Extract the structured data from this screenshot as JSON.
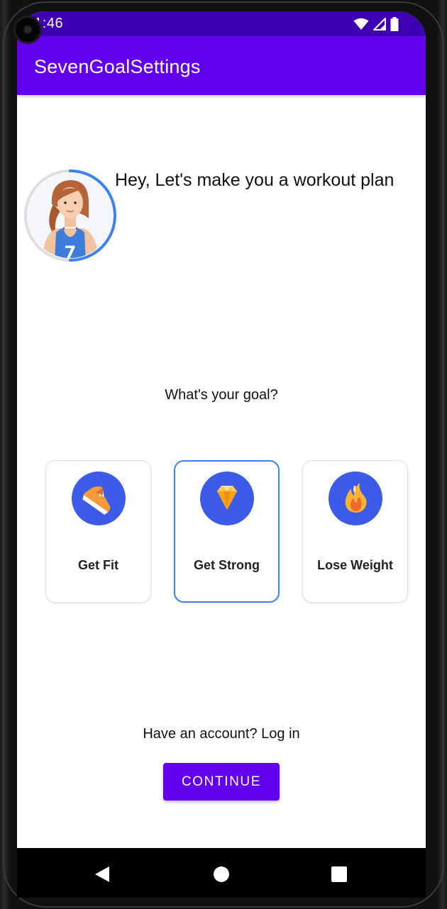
{
  "status_bar": {
    "time": "11:46",
    "icons": [
      "wifi-icon",
      "cell-signal-icon",
      "battery-icon"
    ],
    "background_color": "#3f00b3"
  },
  "app_bar": {
    "title": "SevenGoalSettings",
    "background_color": "#6200ee"
  },
  "hero": {
    "avatar": "female-trainer-avatar",
    "greeting": "Hey, Let's make you a workout plan",
    "progress_ring_color": "#3d82ee",
    "progress_fraction": 0.5
  },
  "goals": {
    "question": "What's your goal?",
    "options": [
      {
        "label": "Get Fit",
        "icon": "running-shoe-icon",
        "selected": false
      },
      {
        "label": "Get Strong",
        "icon": "diamond-icon",
        "selected": true
      },
      {
        "label": "Lose Weight",
        "icon": "flame-icon",
        "selected": false
      }
    ],
    "selected_border_color": "#3d82ee",
    "icon_background_color": "#3b5be8"
  },
  "footer": {
    "login_prompt": "Have an account? Log in",
    "continue_label": "CONTINUE",
    "continue_color": "#6200ee"
  },
  "nav_bar": {
    "buttons": [
      "back-icon",
      "home-icon",
      "recents-icon"
    ]
  }
}
